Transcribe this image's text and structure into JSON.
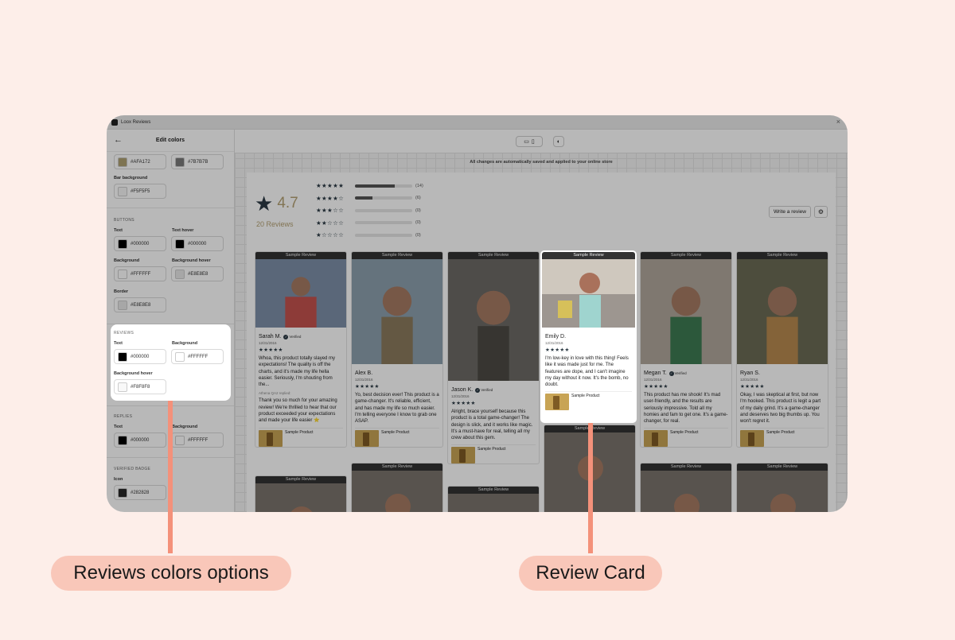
{
  "window": {
    "app_title": "Loox Reviews",
    "close_glyph": "×"
  },
  "sidebar": {
    "back_glyph": "←",
    "title": "Edit colors",
    "top_row": [
      {
        "value": "#AFA172",
        "swatch": "#AFA172"
      },
      {
        "value": "#7B7B7B",
        "swatch": "#7B7B7B"
      }
    ],
    "bar_background": {
      "label": "Bar background",
      "value": "#F5F5F5",
      "swatch": "#F5F5F5"
    },
    "buttons": {
      "section": "BUTTONS",
      "text": {
        "label": "Text",
        "value": "#000000",
        "swatch": "#000000"
      },
      "text_hover": {
        "label": "Text hover",
        "value": "#000000",
        "swatch": "#000000"
      },
      "background": {
        "label": "Background",
        "value": "#FFFFFF",
        "swatch": "#FFFFFF"
      },
      "background_hover": {
        "label": "Background hover",
        "value": "#E8E8E8",
        "swatch": "#E8E8E8"
      },
      "border": {
        "label": "Border",
        "value": "#E8E8E8",
        "swatch": "#E8E8E8"
      }
    },
    "reviews": {
      "section": "REVIEWS",
      "text": {
        "label": "Text",
        "value": "#000000",
        "swatch": "#000000"
      },
      "background": {
        "label": "Background",
        "value": "#FFFFFF",
        "swatch": "#FFFFFF"
      },
      "background_hover": {
        "label": "Background hover",
        "value": "#F8F8F8",
        "swatch": "#F8F8F8"
      }
    },
    "replies": {
      "section": "REPLIES",
      "text": {
        "label": "Text",
        "value": "#000000",
        "swatch": "#000000"
      },
      "background": {
        "label": "Background",
        "value": "#FFFFFF",
        "swatch": "#FFFFFF"
      }
    },
    "verified_badge": {
      "section": "VERIFIED BADGE",
      "icon": {
        "label": "Icon",
        "value": "#282828",
        "swatch": "#282828"
      }
    }
  },
  "toolbar": {
    "desktop_glyph": "▭",
    "mobile_glyph": "▯",
    "contrast_glyph": "◐"
  },
  "notice": "All changes are automatically saved and applied to your online store",
  "summary": {
    "average": "4.7",
    "count_label": "20 Reviews",
    "histogram": [
      {
        "stars": "★★★★★",
        "fraction": 0.7,
        "count": "(14)"
      },
      {
        "stars": "★★★★☆",
        "fraction": 0.3,
        "count": "(6)"
      },
      {
        "stars": "★★★☆☆",
        "fraction": 0,
        "count": "(0)"
      },
      {
        "stars": "★★☆☆☆",
        "fraction": 0,
        "count": "(0)"
      },
      {
        "stars": "★☆☆☆☆",
        "fraction": 0,
        "count": "(0)"
      }
    ],
    "write_review": "Write a review",
    "filter_glyph": "⚙"
  },
  "cards": [
    {
      "badge": "Sample Review",
      "name": "Sarah M.",
      "verified": "Verified",
      "date": "12/31/2016",
      "stars": "★★★★★",
      "text": "Whoa, this product totally slayed my expectations! The quality is off the charts, and it's made my life hella easier. Seriously, I'm shouting from the...",
      "reply_by": "Athena QA2 replied:",
      "reply_text": "Thank you so much for your amazing review! We're thrilled to hear that our product exceeded your expectations and made your life easier ⭐",
      "product": "Sample Product"
    },
    {
      "badge": "Sample Review",
      "name": "Alex B.",
      "date": "12/31/2016",
      "stars": "★★★★★",
      "text": "Yo, best decision ever! This product is a game-changer. It's reliable, efficient, and has made my life so much easier. I'm telling everyone I know to grab one ASAP.",
      "product": "Sample Product"
    },
    {
      "badge": "Sample Review",
      "name": "Jason K.",
      "verified": "Verified",
      "date": "12/31/2016",
      "stars": "★★★★★",
      "text": "Alright, brace yourself because this product is a total game-changer! The design is slick, and it works like magic. It's a must-have for real, telling all my crew about this gem.",
      "product": "Sample Product"
    },
    {
      "badge": "Sample Review",
      "name": "Emily D.",
      "date": "12/31/2016",
      "stars": "★★★★★",
      "text": "I'm low-key in love with this thing! Feels like it was made just for me. The features are dope, and I can't imagine my day without it now. It's the bomb, no doubt.",
      "product": "Sample Product"
    },
    {
      "badge": "Sample Review",
      "name": "Megan T.",
      "verified": "Verified",
      "date": "12/31/2016",
      "stars": "★★★★★",
      "text": "This product has me shook! It's mad user-friendly, and the results are seriously impressive. Told all my homies and fam to get one. It's a game-changer, for real.",
      "product": "Sample Product"
    },
    {
      "badge": "Sample Review",
      "name": "Ryan S.",
      "date": "12/31/2016",
      "stars": "★★★★★",
      "text": "Okay, I was skeptical at first, but now I'm hooked. This product is legit a part of my daily grind. It's a game-changer and deserves two big thumbs up. You won't regret it.",
      "product": "Sample Product"
    }
  ],
  "lower_badges": [
    "Sample Review",
    "Sample Review",
    "Sample Review",
    "Sample Review",
    "Sample Review",
    "Sample Review"
  ],
  "callouts": {
    "left": "Reviews colors options",
    "right": "Review Card"
  },
  "colors": {
    "background": "#fdeee9",
    "callout_fill": "#f9c7b9",
    "connector": "#f4917a",
    "star": "#2b3a44",
    "rating_gold": "#b4a173"
  }
}
